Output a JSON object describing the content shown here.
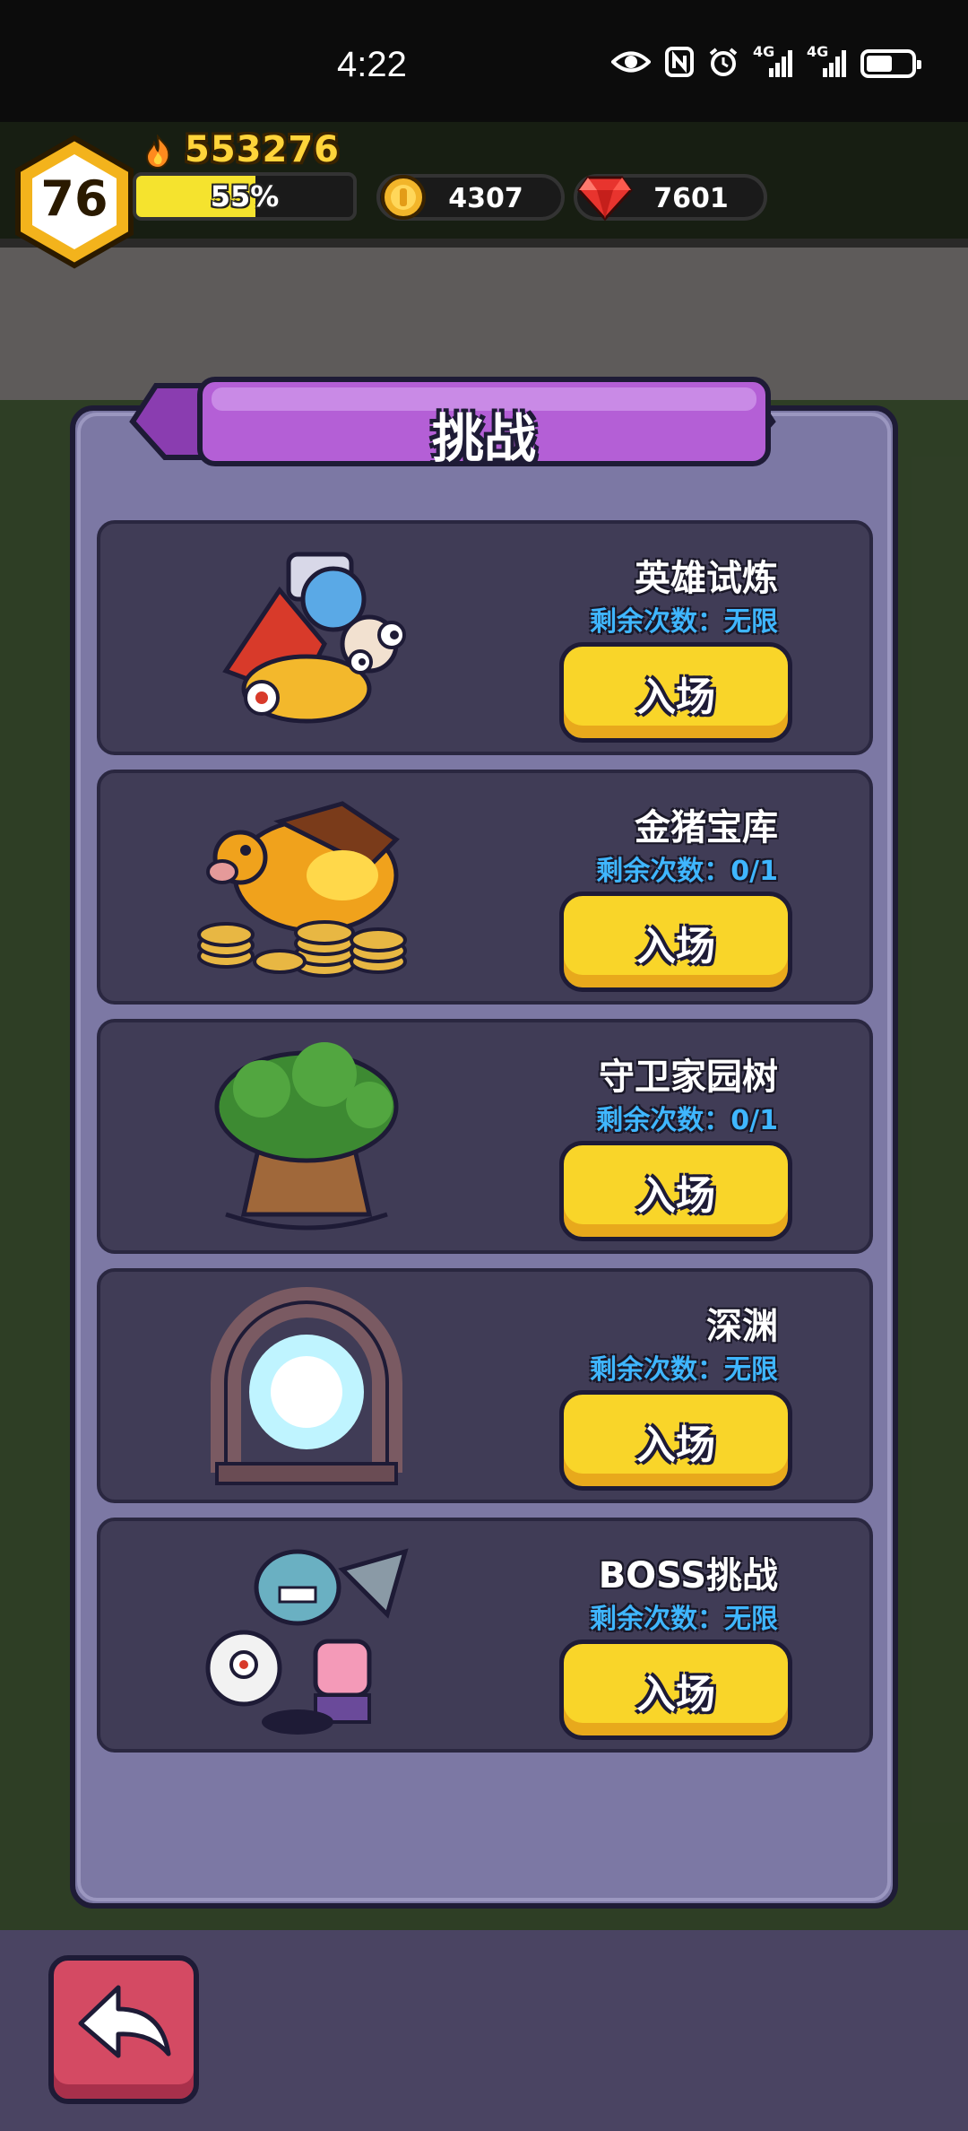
{
  "status_bar": {
    "time": "4:22",
    "network_1": "4G",
    "network_2": "4G"
  },
  "hud": {
    "level": "76",
    "score": "553276",
    "xp_percent_label": "55%",
    "xp_fraction": 0.55,
    "coins": "4307",
    "gems": "7601"
  },
  "modal": {
    "title": "挑战",
    "cards": [
      {
        "title": "英雄试炼",
        "remaining": "剩余次数：无限",
        "enter_label": "入场",
        "art": "hero-trial-icon"
      },
      {
        "title": "金猪宝库",
        "remaining": "剩余次数：0/1",
        "enter_label": "入场",
        "art": "golden-pig-icon"
      },
      {
        "title": "守卫家园树",
        "remaining": "剩余次数：0/1",
        "enter_label": "入场",
        "art": "home-tree-icon"
      },
      {
        "title": "深渊",
        "remaining": "剩余次数：无限",
        "enter_label": "入场",
        "art": "abyss-portal-icon"
      },
      {
        "title": "BOSS挑战",
        "remaining": "剩余次数：无限",
        "enter_label": "入场",
        "art": "boss-monsters-icon"
      }
    ]
  },
  "colors": {
    "modal_bg": "#7c78a4",
    "card_bg": "#403c56",
    "title_ribbon": "#b45fd6",
    "enter_button": "#f9d529",
    "remaining_text": "#3fb6ff",
    "back_button": "#d44a63"
  }
}
